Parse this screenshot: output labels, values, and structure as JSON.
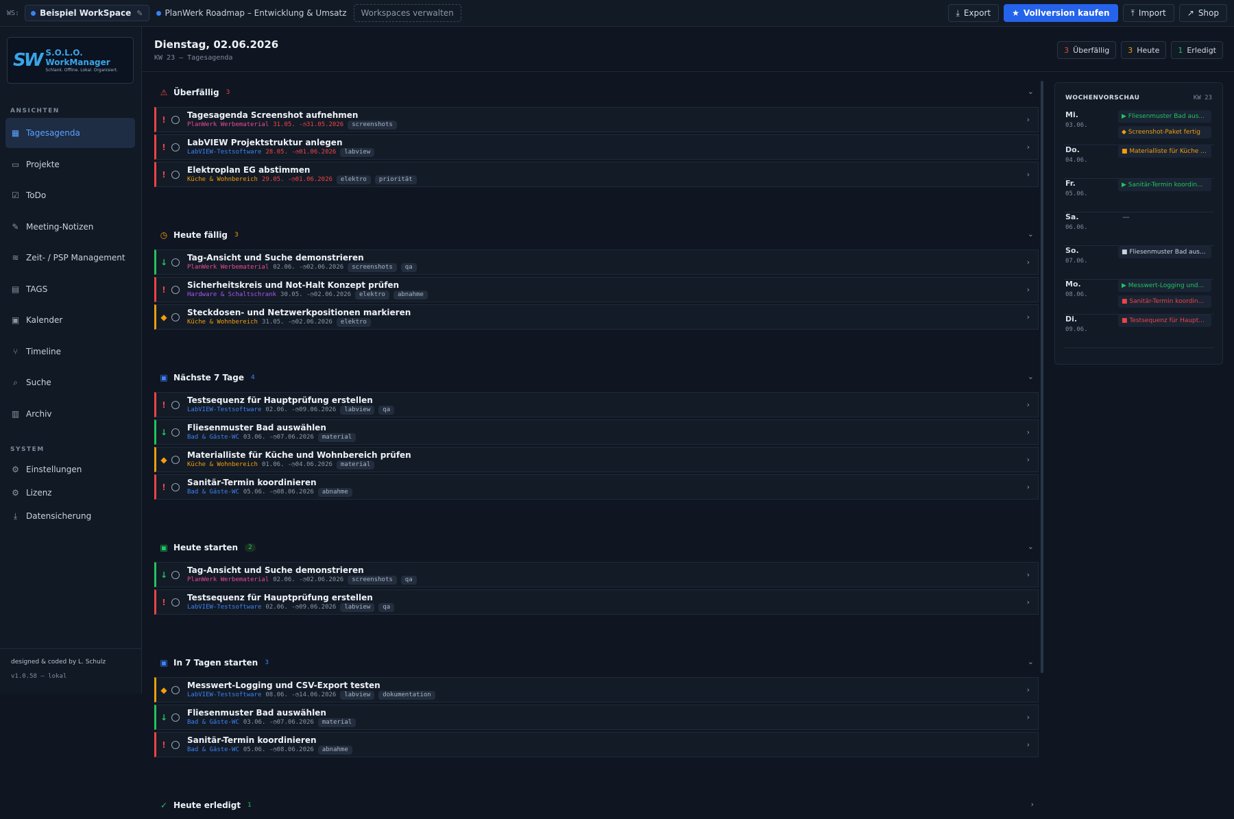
{
  "topbar": {
    "ws_prefix": "WS:",
    "workspace": "Beispiel WorkSpace",
    "project": "PlanWerk Roadmap – Entwicklung & Umsatz",
    "manage": "Workspaces verwalten",
    "buttons": {
      "export": "Export",
      "full": "Vollversion kaufen",
      "import": "Import",
      "shop": "Shop"
    }
  },
  "logo": {
    "mark": "SW",
    "title": "S.O.L.O. WorkManager",
    "subtitle": "Schlank. Offline. Lokal. Organisiert."
  },
  "sidebar": {
    "views_head": "ANSICHTEN",
    "views": [
      {
        "label": "Tagesagenda",
        "icon": "grid-icon"
      },
      {
        "label": "Projekte",
        "icon": "folder-icon"
      },
      {
        "label": "ToDo",
        "icon": "checkbox-icon"
      },
      {
        "label": "Meeting-Notizen",
        "icon": "pencil-icon"
      },
      {
        "label": "Zeit- / PSP Management",
        "icon": "layers-icon"
      },
      {
        "label": "TAGS",
        "icon": "document-icon"
      },
      {
        "label": "Kalender",
        "icon": "calendar-icon"
      },
      {
        "label": "Timeline",
        "icon": "branch-icon"
      },
      {
        "label": "Suche",
        "icon": "search-icon"
      },
      {
        "label": "Archiv",
        "icon": "trash-icon"
      }
    ],
    "system_head": "SYSTEM",
    "system": [
      {
        "label": "Einstellungen",
        "icon": "gear-icon"
      },
      {
        "label": "Lizenz",
        "icon": "gear-icon"
      },
      {
        "label": "Datensicherung",
        "icon": "download-icon"
      }
    ],
    "credit": "designed & coded by L. Schulz",
    "version": "v1.0.58 – lokal"
  },
  "header": {
    "title": "Dienstag, 02.06.2026",
    "subtitle": "KW 23 — Tagesagenda",
    "stats": [
      {
        "n": "3",
        "label": "Überfällig",
        "color": "#ef4444"
      },
      {
        "n": "3",
        "label": "Heute",
        "color": "#f59e0b"
      },
      {
        "n": "1",
        "label": "Erledigt",
        "color": "#22c55e"
      }
    ]
  },
  "colors": {
    "high": "#ef4444",
    "medium": "#f59e0b",
    "low": "#22c55e",
    "proj_planwerk": "#ec4899",
    "proj_labview": "#3b82f6",
    "proj_kueche": "#f59e0b",
    "proj_hardware": "#a855f7",
    "proj_bad": "#3b82f6",
    "overdue_date": "#ef4444"
  },
  "sections": [
    {
      "title": "Überfällig",
      "count": "3",
      "icon": "warning-icon",
      "color": "#ef4444",
      "pill": false,
      "tasks": [
        {
          "prio": "high",
          "title": "Tagesagenda Screenshot aufnehmen",
          "project": "PlanWerk Werbematerial",
          "proj_color": "#ec4899",
          "start": "31.05.",
          "due": "31.05.2026",
          "overdue": true,
          "tags": [
            "screenshots"
          ]
        },
        {
          "prio": "high",
          "title": "LabVIEW Projektstruktur anlegen",
          "project": "LabVIEW-Testsoftware",
          "proj_color": "#3b82f6",
          "start": "28.05.",
          "due": "01.06.2026",
          "overdue": true,
          "tags": [
            "labview"
          ]
        },
        {
          "prio": "high",
          "title": "Elektroplan EG abstimmen",
          "project": "Küche & Wohnbereich",
          "proj_color": "#f59e0b",
          "start": "29.05.",
          "due": "01.06.2026",
          "overdue": true,
          "tags": [
            "elektro",
            "priorität"
          ]
        }
      ]
    },
    {
      "title": "Heute fällig",
      "count": "3",
      "icon": "clock-icon",
      "color": "#f59e0b",
      "pill": false,
      "tasks": [
        {
          "prio": "low",
          "title": "Tag-Ansicht und Suche demonstrieren",
          "project": "PlanWerk Werbematerial",
          "proj_color": "#ec4899",
          "start": "02.06.",
          "due": "02.06.2026",
          "overdue": false,
          "tags": [
            "screenshots",
            "qa"
          ]
        },
        {
          "prio": "high",
          "title": "Sicherheitskreis und Not-Halt Konzept prüfen",
          "project": "Hardware & Schaltschrank",
          "proj_color": "#a855f7",
          "start": "30.05.",
          "due": "02.06.2026",
          "overdue": false,
          "tags": [
            "elektro",
            "abnahme"
          ]
        },
        {
          "prio": "medium",
          "title": "Steckdosen- und Netzwerkpositionen markieren",
          "project": "Küche & Wohnbereich",
          "proj_color": "#f59e0b",
          "start": "31.05.",
          "due": "02.06.2026",
          "overdue": false,
          "tags": [
            "elektro"
          ]
        }
      ]
    },
    {
      "title": "Nächste 7 Tage",
      "count": "4",
      "icon": "calendar-icon",
      "color": "#3b82f6",
      "pill": false,
      "tasks": [
        {
          "prio": "high",
          "title": "Testsequenz für Hauptprüfung erstellen",
          "project": "LabVIEW-Testsoftware",
          "proj_color": "#3b82f6",
          "start": "02.06.",
          "due": "09.06.2026",
          "overdue": false,
          "tags": [
            "labview",
            "qa"
          ]
        },
        {
          "prio": "low",
          "title": "Fliesenmuster Bad auswählen",
          "project": "Bad & Gäste-WC",
          "proj_color": "#3b82f6",
          "start": "03.06.",
          "due": "07.06.2026",
          "overdue": false,
          "tags": [
            "material"
          ]
        },
        {
          "prio": "medium",
          "title": "Materialliste für Küche und Wohnbereich prüfen",
          "project": "Küche & Wohnbereich",
          "proj_color": "#f59e0b",
          "start": "01.06.",
          "due": "04.06.2026",
          "overdue": false,
          "tags": [
            "material"
          ]
        },
        {
          "prio": "high",
          "title": "Sanitär-Termin koordinieren",
          "project": "Bad & Gäste-WC",
          "proj_color": "#3b82f6",
          "start": "05.06.",
          "due": "08.06.2026",
          "overdue": false,
          "tags": [
            "abnahme"
          ]
        }
      ]
    },
    {
      "title": "Heute starten",
      "count": "2",
      "icon": "calendar-start-icon",
      "color": "#22c55e",
      "pill": true,
      "tasks": [
        {
          "prio": "low",
          "title": "Tag-Ansicht und Suche demonstrieren",
          "project": "PlanWerk Werbematerial",
          "proj_color": "#ec4899",
          "start": "02.06.",
          "due": "02.06.2026",
          "overdue": false,
          "tags": [
            "screenshots",
            "qa"
          ]
        },
        {
          "prio": "high",
          "title": "Testsequenz für Hauptprüfung erstellen",
          "project": "LabVIEW-Testsoftware",
          "proj_color": "#3b82f6",
          "start": "02.06.",
          "due": "09.06.2026",
          "overdue": false,
          "tags": [
            "labview",
            "qa"
          ]
        }
      ]
    },
    {
      "title": "In 7 Tagen starten",
      "count": "3",
      "icon": "calendar-icon",
      "color": "#3b82f6",
      "pill": false,
      "tasks": [
        {
          "prio": "medium",
          "title": "Messwert-Logging und CSV-Export testen",
          "project": "LabVIEW-Testsoftware",
          "proj_color": "#3b82f6",
          "start": "08.06.",
          "due": "14.06.2026",
          "overdue": false,
          "tags": [
            "labview",
            "dokumentation"
          ]
        },
        {
          "prio": "low",
          "title": "Fliesenmuster Bad auswählen",
          "project": "Bad & Gäste-WC",
          "proj_color": "#3b82f6",
          "start": "03.06.",
          "due": "07.06.2026",
          "overdue": false,
          "tags": [
            "material"
          ]
        },
        {
          "prio": "high",
          "title": "Sanitär-Termin koordinieren",
          "project": "Bad & Gäste-WC",
          "proj_color": "#3b82f6",
          "start": "05.06.",
          "due": "08.06.2026",
          "overdue": false,
          "tags": [
            "abnahme"
          ]
        }
      ]
    },
    {
      "title": "Heute erledigt",
      "count": "1",
      "icon": "check-circle-icon",
      "color": "#22c55e",
      "pill": false,
      "collapsed": true,
      "tasks": []
    }
  ],
  "week": {
    "title": "WOCHENVORSCHAU",
    "kw": "KW 23",
    "days": [
      {
        "name": "Mi.",
        "date": "03.06.",
        "events": [
          {
            "text": "▶ Fliesenmuster Bad aus...",
            "color": "#22c55e"
          },
          {
            "text": "◆ Screenshot-Paket fertig",
            "color": "#f59e0b"
          }
        ]
      },
      {
        "name": "Do.",
        "date": "04.06.",
        "events": [
          {
            "text": "■ Materialliste für Küche ...",
            "color": "#f59e0b"
          }
        ]
      },
      {
        "name": "Fr.",
        "date": "05.06.",
        "events": [
          {
            "text": "▶ Sanitär-Termin koordin...",
            "color": "#22c55e"
          }
        ]
      },
      {
        "name": "Sa.",
        "date": "06.06.",
        "events": [],
        "empty": "—"
      },
      {
        "name": "So.",
        "date": "07.06.",
        "events": [
          {
            "text": "■ Fliesenmuster Bad aus...",
            "color": "#c9d2de"
          }
        ]
      },
      {
        "name": "Mo.",
        "date": "08.06.",
        "events": [
          {
            "text": "▶ Messwert-Logging und...",
            "color": "#22c55e"
          },
          {
            "text": "■ Sanitär-Termin koordin...",
            "color": "#ef4444"
          }
        ]
      },
      {
        "name": "Di.",
        "date": "09.06.",
        "events": [
          {
            "text": "■ Testsequenz für Haupt...",
            "color": "#ef4444"
          }
        ]
      }
    ]
  }
}
